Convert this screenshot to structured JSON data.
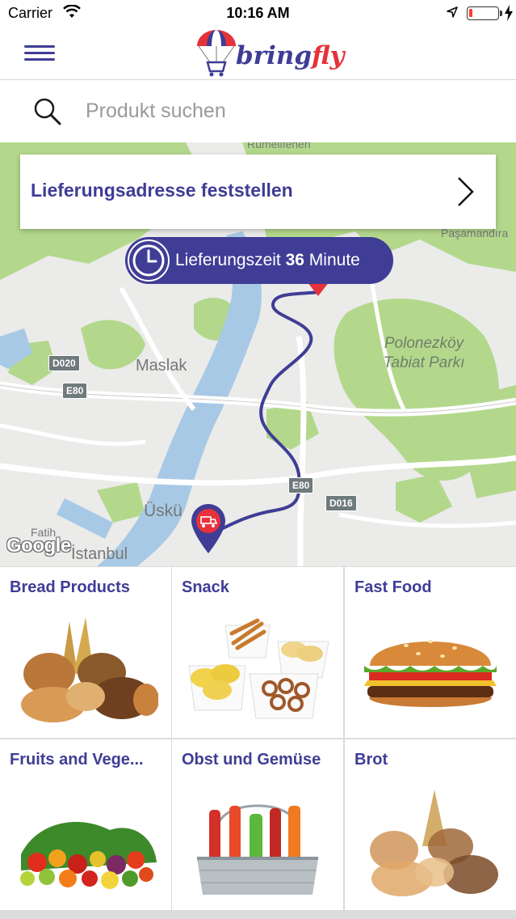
{
  "status_bar": {
    "carrier": "Carrier",
    "time": "10:16 AM",
    "battery_color": "#ff3b30"
  },
  "header": {
    "menu_icon": "hamburger-menu-icon",
    "logo_text_part1": "bring",
    "logo_text_part2": "fly",
    "brand_color": "#3f3d95",
    "accent_color": "#e6323a"
  },
  "search": {
    "placeholder": "Produkt suchen",
    "icon": "search-icon"
  },
  "map": {
    "address_prompt": "Lieferungsadresse feststellen",
    "delivery_label": "Lieferungszeit",
    "delivery_minutes": "36",
    "delivery_unit": "Minute",
    "places": {
      "maslak": "Maslak",
      "polonezkoy_1": "Polonezköy",
      "polonezkoy_2": "Tabiat Parkı",
      "uskudar": "Üskü",
      "fatih": "Fatih",
      "istanbul": "İstanbul",
      "pasamandira": "Paşamandıra",
      "rumelifeneri": "Rumelifeneri"
    },
    "roads": {
      "d020": "D020",
      "e80_a": "E80",
      "e80_b": "E80",
      "d016": "D016"
    },
    "attribution": "Google"
  },
  "categories": [
    {
      "name": "Bread Products",
      "image": "bread-products-image"
    },
    {
      "name": "Snack",
      "image": "snack-image"
    },
    {
      "name": "Fast Food",
      "image": "burger-image"
    },
    {
      "name": "Fruits and Vege...",
      "image": "fruits-vegetables-image"
    },
    {
      "name": "Obst und Gemüse",
      "image": "drinks-bucket-image"
    },
    {
      "name": "Brot",
      "image": "bread-image"
    }
  ]
}
